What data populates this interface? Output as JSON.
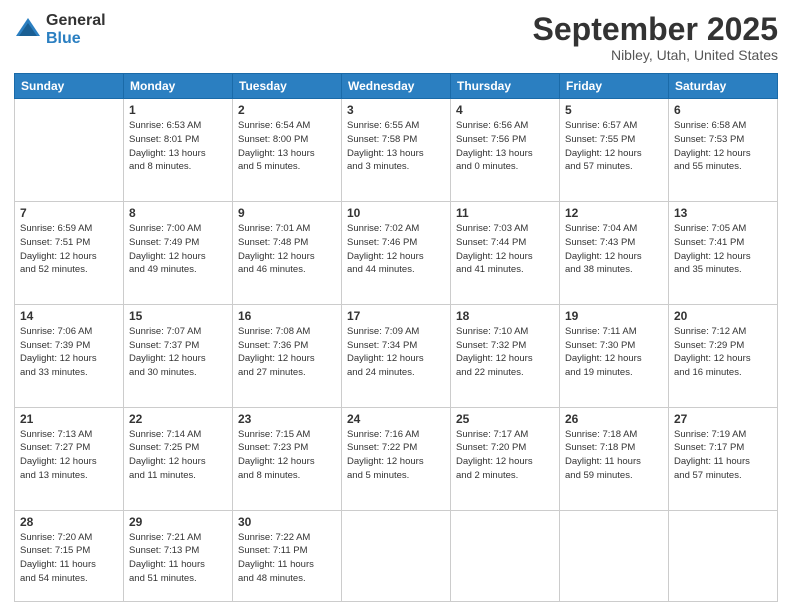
{
  "header": {
    "logo_general": "General",
    "logo_blue": "Blue",
    "title": "September 2025",
    "location": "Nibley, Utah, United States"
  },
  "days_of_week": [
    "Sunday",
    "Monday",
    "Tuesday",
    "Wednesday",
    "Thursday",
    "Friday",
    "Saturday"
  ],
  "weeks": [
    [
      {
        "day": "",
        "info": ""
      },
      {
        "day": "1",
        "info": "Sunrise: 6:53 AM\nSunset: 8:01 PM\nDaylight: 13 hours\nand 8 minutes."
      },
      {
        "day": "2",
        "info": "Sunrise: 6:54 AM\nSunset: 8:00 PM\nDaylight: 13 hours\nand 5 minutes."
      },
      {
        "day": "3",
        "info": "Sunrise: 6:55 AM\nSunset: 7:58 PM\nDaylight: 13 hours\nand 3 minutes."
      },
      {
        "day": "4",
        "info": "Sunrise: 6:56 AM\nSunset: 7:56 PM\nDaylight: 13 hours\nand 0 minutes."
      },
      {
        "day": "5",
        "info": "Sunrise: 6:57 AM\nSunset: 7:55 PM\nDaylight: 12 hours\nand 57 minutes."
      },
      {
        "day": "6",
        "info": "Sunrise: 6:58 AM\nSunset: 7:53 PM\nDaylight: 12 hours\nand 55 minutes."
      }
    ],
    [
      {
        "day": "7",
        "info": "Sunrise: 6:59 AM\nSunset: 7:51 PM\nDaylight: 12 hours\nand 52 minutes."
      },
      {
        "day": "8",
        "info": "Sunrise: 7:00 AM\nSunset: 7:49 PM\nDaylight: 12 hours\nand 49 minutes."
      },
      {
        "day": "9",
        "info": "Sunrise: 7:01 AM\nSunset: 7:48 PM\nDaylight: 12 hours\nand 46 minutes."
      },
      {
        "day": "10",
        "info": "Sunrise: 7:02 AM\nSunset: 7:46 PM\nDaylight: 12 hours\nand 44 minutes."
      },
      {
        "day": "11",
        "info": "Sunrise: 7:03 AM\nSunset: 7:44 PM\nDaylight: 12 hours\nand 41 minutes."
      },
      {
        "day": "12",
        "info": "Sunrise: 7:04 AM\nSunset: 7:43 PM\nDaylight: 12 hours\nand 38 minutes."
      },
      {
        "day": "13",
        "info": "Sunrise: 7:05 AM\nSunset: 7:41 PM\nDaylight: 12 hours\nand 35 minutes."
      }
    ],
    [
      {
        "day": "14",
        "info": "Sunrise: 7:06 AM\nSunset: 7:39 PM\nDaylight: 12 hours\nand 33 minutes."
      },
      {
        "day": "15",
        "info": "Sunrise: 7:07 AM\nSunset: 7:37 PM\nDaylight: 12 hours\nand 30 minutes."
      },
      {
        "day": "16",
        "info": "Sunrise: 7:08 AM\nSunset: 7:36 PM\nDaylight: 12 hours\nand 27 minutes."
      },
      {
        "day": "17",
        "info": "Sunrise: 7:09 AM\nSunset: 7:34 PM\nDaylight: 12 hours\nand 24 minutes."
      },
      {
        "day": "18",
        "info": "Sunrise: 7:10 AM\nSunset: 7:32 PM\nDaylight: 12 hours\nand 22 minutes."
      },
      {
        "day": "19",
        "info": "Sunrise: 7:11 AM\nSunset: 7:30 PM\nDaylight: 12 hours\nand 19 minutes."
      },
      {
        "day": "20",
        "info": "Sunrise: 7:12 AM\nSunset: 7:29 PM\nDaylight: 12 hours\nand 16 minutes."
      }
    ],
    [
      {
        "day": "21",
        "info": "Sunrise: 7:13 AM\nSunset: 7:27 PM\nDaylight: 12 hours\nand 13 minutes."
      },
      {
        "day": "22",
        "info": "Sunrise: 7:14 AM\nSunset: 7:25 PM\nDaylight: 12 hours\nand 11 minutes."
      },
      {
        "day": "23",
        "info": "Sunrise: 7:15 AM\nSunset: 7:23 PM\nDaylight: 12 hours\nand 8 minutes."
      },
      {
        "day": "24",
        "info": "Sunrise: 7:16 AM\nSunset: 7:22 PM\nDaylight: 12 hours\nand 5 minutes."
      },
      {
        "day": "25",
        "info": "Sunrise: 7:17 AM\nSunset: 7:20 PM\nDaylight: 12 hours\nand 2 minutes."
      },
      {
        "day": "26",
        "info": "Sunrise: 7:18 AM\nSunset: 7:18 PM\nDaylight: 11 hours\nand 59 minutes."
      },
      {
        "day": "27",
        "info": "Sunrise: 7:19 AM\nSunset: 7:17 PM\nDaylight: 11 hours\nand 57 minutes."
      }
    ],
    [
      {
        "day": "28",
        "info": "Sunrise: 7:20 AM\nSunset: 7:15 PM\nDaylight: 11 hours\nand 54 minutes."
      },
      {
        "day": "29",
        "info": "Sunrise: 7:21 AM\nSunset: 7:13 PM\nDaylight: 11 hours\nand 51 minutes."
      },
      {
        "day": "30",
        "info": "Sunrise: 7:22 AM\nSunset: 7:11 PM\nDaylight: 11 hours\nand 48 minutes."
      },
      {
        "day": "",
        "info": ""
      },
      {
        "day": "",
        "info": ""
      },
      {
        "day": "",
        "info": ""
      },
      {
        "day": "",
        "info": ""
      }
    ]
  ]
}
